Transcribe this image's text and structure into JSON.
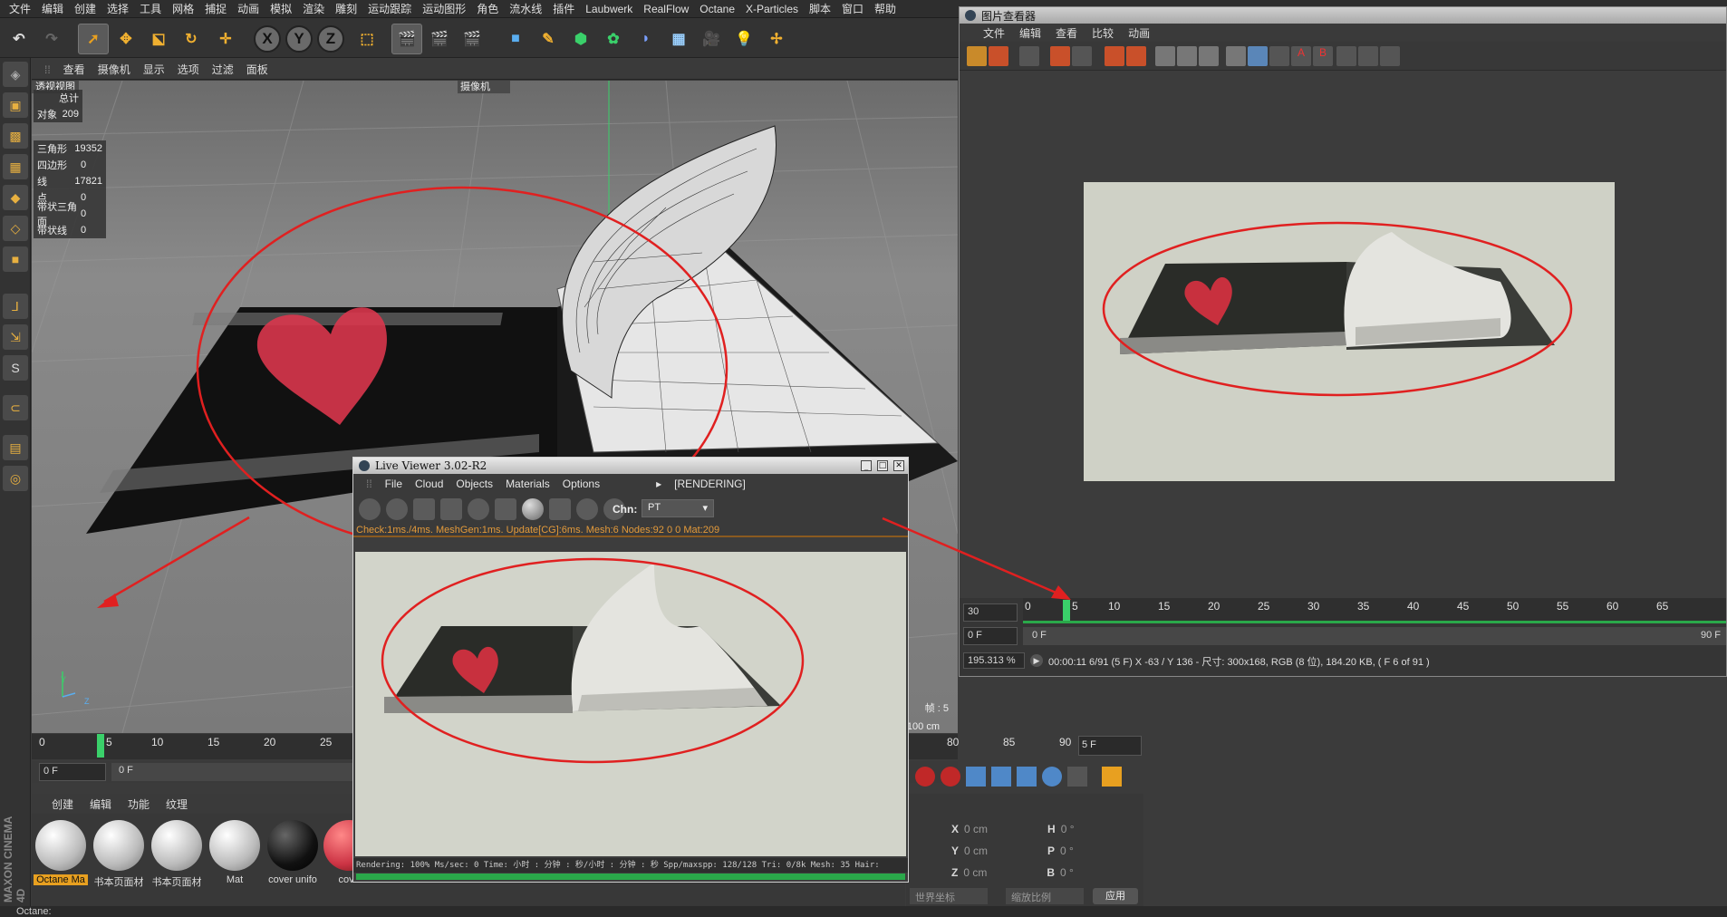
{
  "menubar": [
    "文件",
    "编辑",
    "创建",
    "选择",
    "工具",
    "网格",
    "捕捉",
    "动画",
    "模拟",
    "渲染",
    "雕刻",
    "运动跟踪",
    "运动图形",
    "角色",
    "流水线",
    "插件",
    "Laubwerk",
    "RealFlow",
    "Octane",
    "X-Particles",
    "脚本",
    "窗口",
    "帮助"
  ],
  "viewport": {
    "menu": [
      "查看",
      "摄像机",
      "显示",
      "选项",
      "过滤",
      "面板"
    ],
    "view_label": "透视视图",
    "camera_label": "摄像机",
    "stats_total": {
      "header": "总计",
      "object_label": "对象",
      "object_value": "209"
    },
    "stats": [
      {
        "label": "三角形",
        "value": "19352"
      },
      {
        "label": "四边形",
        "value": "0"
      },
      {
        "label": "线",
        "value": "17821"
      },
      {
        "label": "点",
        "value": "0"
      },
      {
        "label": "带状三角面",
        "value": "0"
      },
      {
        "label": "带状线",
        "value": "0"
      }
    ],
    "frame_readout": "帧 : 5",
    "grid_readout": "网格间距 : 100 cm",
    "axis_y": "Y",
    "axis_z": "Z"
  },
  "timeline": {
    "ticks": [
      "0",
      "5",
      "10",
      "15",
      "20",
      "25",
      "80",
      "85",
      "90"
    ],
    "end_field": "5 F",
    "start_field": "0 F",
    "slider_label": "0 F",
    "current_frame": 5,
    "max_frame": 90
  },
  "material_panel": {
    "menu": [
      "创建",
      "编辑",
      "功能",
      "纹理"
    ],
    "materials": [
      {
        "label": "Octane Ma",
        "color": "#ffffff",
        "selected": true
      },
      {
        "label": "书本页面材",
        "color": "#ffffff"
      },
      {
        "label": "书本页面材",
        "color": "#ffffff"
      },
      {
        "label": "Mat",
        "color": "#ffffff"
      },
      {
        "label": "cover unifo",
        "color": "#111111"
      },
      {
        "label": "cover",
        "color": "#cc3344"
      }
    ]
  },
  "coords": {
    "rows": [
      {
        "axis": "X",
        "pos": "0 cm",
        "rot_label": "H",
        "rot": "0 °"
      },
      {
        "axis": "Y",
        "pos": "0 cm",
        "rot_label": "P",
        "rot": "0 °"
      },
      {
        "axis": "Z",
        "pos": "0 cm",
        "rot_label": "B",
        "rot": "0 °"
      }
    ],
    "world_select": "世界坐标",
    "scale_select": "缩放比例",
    "apply_button": "应用"
  },
  "picture_viewer": {
    "title": "图片查看器",
    "menu": [
      "文件",
      "编辑",
      "查看",
      "比较",
      "动画"
    ],
    "fps": "30",
    "frame_field": "0 F",
    "slider_start": "0 F",
    "slider_end": "90 F",
    "ticks": [
      "0",
      "5",
      "10",
      "15",
      "20",
      "25",
      "30",
      "35",
      "40",
      "45",
      "50",
      "55",
      "60",
      "65"
    ],
    "current_frame": 5,
    "zoom": "195.313 %",
    "info": "00:00:11 6/91 (5 F)    X -63 / Y 136 - 尺寸: 300x168, RGB (8 位), 184.20 KB,  ( F 6 of 91 )"
  },
  "live_viewer": {
    "title": "Live Viewer 3.02-R2",
    "menu": [
      "File",
      "Cloud",
      "Objects",
      "Materials",
      "Options"
    ],
    "state": "[RENDERING]",
    "chn_label": "Chn:",
    "chn_value": "PT",
    "info": "Check:1ms./4ms. MeshGen:1ms. Update[CG]:6ms. Mesh:6 Nodes:92  0 0 Mat:209",
    "status": "Rendering: 100%    Ms/sec: 0  Time: 小时 : 分钟 : 秒/小时 : 分钟 : 秒    Spp/maxspp: 128/128   Tri: 0/8k  Mesh: 35   Hair:",
    "progress": 1.0
  },
  "statusbar": "Octane:",
  "annotation_color": "#e02020",
  "accent_green": "#3ad06a"
}
